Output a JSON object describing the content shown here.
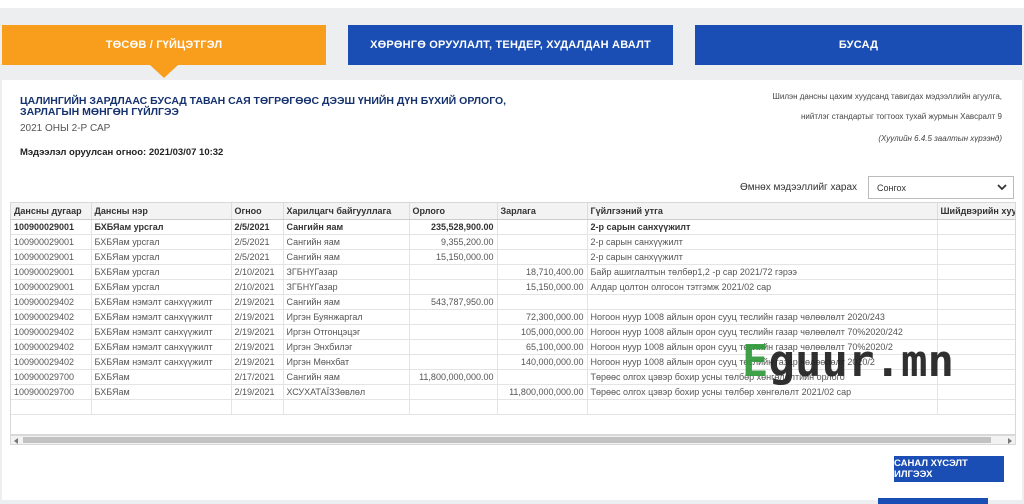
{
  "tabs": [
    {
      "label": "ТӨСӨВ / ГҮЙЦЭТГЭЛ"
    },
    {
      "label": "ХӨРӨНГӨ ОРУУЛАЛТ, ТЕНДЕР, ХУДАЛДАН АВАЛТ"
    },
    {
      "label": "БУСАД"
    }
  ],
  "report": {
    "title": "ЦАЛИНГИЙН ЗАРДЛААС БУСАД ТАВАН САЯ ТӨГРӨГӨӨС ДЭЭШ ҮНИЙН ДҮН БҮХИЙ ОРЛОГО, ЗАРЛАГЫН МӨНГӨН ГҮЙЛГЭЭ",
    "period": "2021 ОНЫ 2-Р САР",
    "updated_label": "Мэдээлэл оруулсан огноо:",
    "updated_value": "2021/03/07 10:32",
    "note_line1": "Шилэн дансны цахим хуудсанд тавигдах мэдээллийн агуулга,",
    "note_line2": "нийтлэг стандартыг тогтоох тухай журмын Хавсралт 9",
    "note_line3": "(Хуулийн 6.4.5 заалтын хүрээнд)"
  },
  "filter": {
    "label": "Өмнөх мэдээллийг харах",
    "selected": "Сонгох"
  },
  "table": {
    "headers": [
      "Дансны дугаар",
      "Дансны нэр",
      "Огноо",
      "Харилцагч байгууллага",
      "Орлого",
      "Зарлага",
      "Гүйлгээний утга",
      "Шийдвэрийн хуулб"
    ],
    "rows": [
      {
        "bold": true,
        "cells": [
          "100900029001",
          "БХБЯам урсгал",
          "2/5/2021",
          "Сангийн яам",
          "235,528,900.00",
          "",
          "2-р сарын санхүүжилт",
          ""
        ]
      },
      {
        "bold": false,
        "cells": [
          "100900029001",
          "БХБЯам урсгал",
          "2/5/2021",
          "Сангийн яам",
          "9,355,200.00",
          "",
          "2-р сарын санхүүжилт",
          ""
        ]
      },
      {
        "bold": false,
        "cells": [
          "100900029001",
          "БХБЯам урсгал",
          "2/5/2021",
          "Сангийн яам",
          "15,150,000.00",
          "",
          "2-р сарын санхүүжилт",
          ""
        ]
      },
      {
        "bold": false,
        "cells": [
          "100900029001",
          "БХБЯам урсгал",
          "2/10/2021",
          "ЗГБНҮГазар",
          "",
          "18,710,400.00",
          "Байр ашиглалтын төлбөр1,2 -р сар 2021/72 гэрээ",
          ""
        ]
      },
      {
        "bold": false,
        "cells": [
          "100900029001",
          "БХБЯам урсгал",
          "2/10/2021",
          "ЗГБНҮГазар",
          "",
          "15,150,000.00",
          "Алдар цолтон олгосон тэтгэмж 2021/02 сар",
          ""
        ]
      },
      {
        "bold": false,
        "cells": [
          "100900029402",
          "БХБЯам нэмэлт санхүүжилт",
          "2/19/2021",
          "Сангийн яам",
          "543,787,950.00",
          "",
          "",
          ""
        ]
      },
      {
        "bold": false,
        "cells": [
          "100900029402",
          "БХБЯам нэмэлт санхүүжилт",
          "2/19/2021",
          "Иргэн Буянжаргал",
          "",
          "72,300,000.00",
          "Ногоон нуур 1008 айлын орон сууц теслийн газар чөлөөлөлт 2020/243",
          ""
        ]
      },
      {
        "bold": false,
        "cells": [
          "100900029402",
          "БХБЯам нэмэлт санхүүжилт",
          "2/19/2021",
          "Иргэн Отгонцэцэг",
          "",
          "105,000,000.00",
          "Ногоон нуур 1008 айлын орон сууц теслийн газар чөлөөлөлт 70%2020/242",
          ""
        ]
      },
      {
        "bold": false,
        "cells": [
          "100900029402",
          "БХБЯам нэмэлт санхүүжилт",
          "2/19/2021",
          "Иргэн Энхбилэг",
          "",
          "65,100,000.00",
          "Ногоон нуур 1008 айлын орон сууц теслийн газар чөлөөлөлт 70%2020/2",
          ""
        ]
      },
      {
        "bold": false,
        "cells": [
          "100900029402",
          "БХБЯам нэмэлт санхүүжилт",
          "2/19/2021",
          "Иргэн Мөнхбат",
          "",
          "140,000,000.00",
          "Ногоон нуур 1008 айлын орон сууц теслийн газар чөлөөлөлт 2020/2",
          ""
        ]
      },
      {
        "bold": false,
        "cells": [
          "100900029700",
          "БХБЯам",
          "2/17/2021",
          "Сангийн яам",
          "11,800,000,000.00",
          "",
          "Төрөөс олгох цэвэр бохир усны төлбөр хөнгөлөлтийн орлого",
          ""
        ]
      },
      {
        "bold": false,
        "cells": [
          "100900029700",
          "БХБЯам",
          "2/19/2021",
          "ХСУХАТАЇЗЗөвлөл",
          "",
          "11,800,000,000.00",
          "Төрөөс олгох цэвэр бохир усны төлбөр хөнгөлөлт 2021/02 сар",
          ""
        ]
      },
      {
        "bold": false,
        "cells": [
          "",
          "",
          "",
          "",
          "",
          "",
          "",
          ""
        ]
      }
    ]
  },
  "submit": {
    "label": "САНАЛ ХҮСЭЛТ ИЛГЭЭХ"
  },
  "watermark": {
    "brand_e": "E",
    "brand_rest": "guur.mn"
  },
  "colors": {
    "accent_orange": "#f99d1c",
    "primary_blue": "#1b4eb5",
    "title_navy": "#15326e"
  }
}
